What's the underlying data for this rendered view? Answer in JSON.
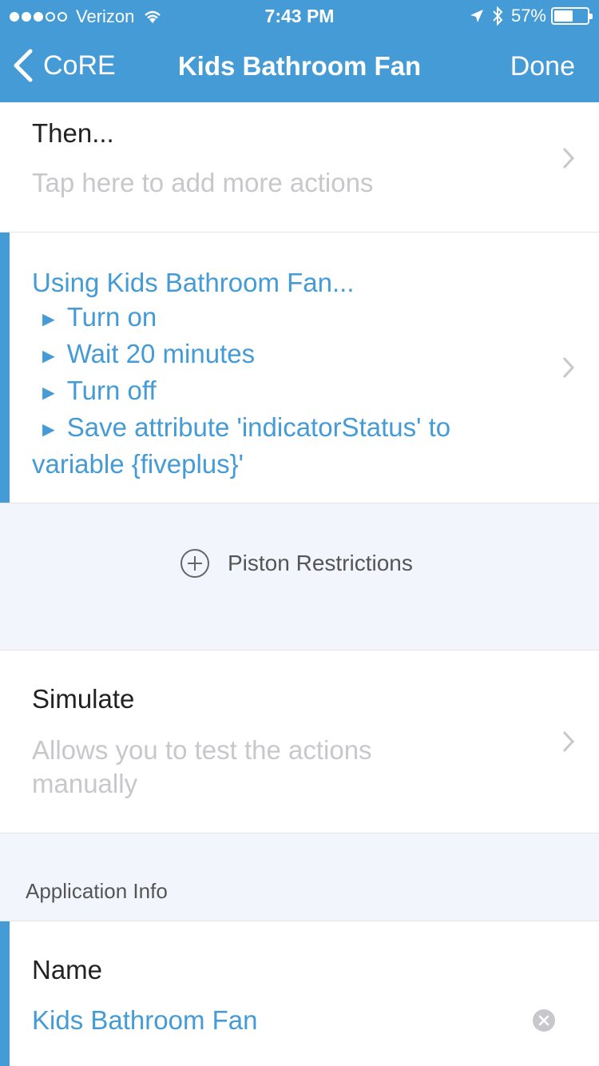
{
  "status_bar": {
    "carrier": "Verizon",
    "time": "7:43 PM",
    "battery": "57%",
    "battery_level": 0.57,
    "signal_bars_filled": 3,
    "signal_bars_total": 5
  },
  "nav": {
    "back_label": "CoRE",
    "title": "Kids Bathroom Fan",
    "done_label": "Done"
  },
  "then_row": {
    "title": "Then...",
    "subtitle": "Tap here to add more actions"
  },
  "actions": {
    "header": "Using Kids Bathroom Fan...",
    "arrow": "►",
    "items": [
      "Turn on",
      "Wait 20 minutes",
      "Turn off",
      "Save attribute 'indicatorStatus' to"
    ],
    "continuation": "variable {fiveplus}'"
  },
  "restrictions": {
    "label": "Piston Restrictions"
  },
  "simulate": {
    "title": "Simulate",
    "subtitle_line1": "Allows you to test the actions",
    "subtitle_line2": "manually"
  },
  "app_info": {
    "header": "Application Info",
    "name_label": "Name",
    "name_value": "Kids Bathroom Fan"
  },
  "colors": {
    "accent": "#449bd6",
    "background_gray": "#f2f6fc",
    "placeholder": "#c7c7cc"
  },
  "icons": [
    "chevron-left-icon",
    "chevron-right-icon",
    "plus-circle-icon",
    "clear-icon",
    "wifi-icon",
    "location-icon",
    "bluetooth-icon",
    "battery-icon"
  ]
}
